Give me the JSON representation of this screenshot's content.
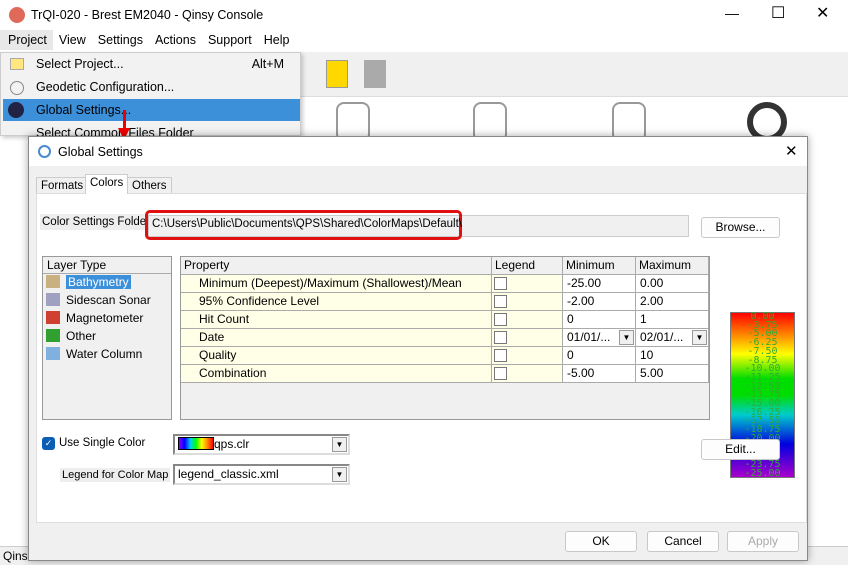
{
  "app": {
    "title": "TrQI-020 - Brest EM2040 - Qinsy Console",
    "status_fragment": "Qins"
  },
  "menubar": [
    "Project",
    "View",
    "Settings",
    "Actions",
    "Support",
    "Help"
  ],
  "project_menu": [
    {
      "label": "Select Project...",
      "shortcut": "Alt+M"
    },
    {
      "label": "Geodetic Configuration...",
      "shortcut": ""
    },
    {
      "label": "Global Settings...",
      "shortcut": ""
    },
    {
      "label": "Select Common Files Folder",
      "shortcut": ""
    }
  ],
  "dialog": {
    "title": "Global Settings",
    "tabs": [
      "Formats",
      "Colors",
      "Others"
    ],
    "active_tab": "Colors",
    "folder_label": "Color Settings Folder",
    "folder_value": "C:\\Users\\Public\\Documents\\QPS\\Shared\\ColorMaps\\Default\\",
    "browse": "Browse...",
    "layer_header": "Layer Type",
    "layers": [
      "Bathymetry",
      "Sidescan Sonar",
      "Magnetometer",
      "Other",
      "Water Column"
    ],
    "grid_headers": [
      "Property",
      "Legend",
      "Minimum",
      "Maximum"
    ],
    "rows": [
      {
        "property": "Minimum (Deepest)/Maximum (Shallowest)/Mean",
        "min": "-25.00",
        "max": "0.00"
      },
      {
        "property": "95% Confidence Level",
        "min": "-2.00",
        "max": "2.00"
      },
      {
        "property": "Hit Count",
        "min": "0",
        "max": "1"
      },
      {
        "property": "Date",
        "min": "01/01/...",
        "max": "02/01/..."
      },
      {
        "property": "Quality",
        "min": "0",
        "max": "10"
      },
      {
        "property": "Combination",
        "min": "-5.00",
        "max": "5.00"
      }
    ],
    "legend_values": [
      "0.00",
      "-3.75",
      "-5.00",
      "-6.25",
      "-7.50",
      "-8.75",
      "-10.00",
      "-11.25",
      "-12.50",
      "-13.75",
      "-15.00",
      "-16.25",
      "-17.50",
      "-18.75",
      "-20.00",
      "-21.25",
      "-22.50",
      "-23.75",
      "-25.00"
    ],
    "use_single_color": "Use Single Color",
    "color_map": "qps.clr",
    "legend_label": "Legend for Color Map",
    "legend_file": "legend_classic.xml",
    "edit": "Edit...",
    "ok": "OK",
    "cancel": "Cancel",
    "apply": "Apply"
  }
}
